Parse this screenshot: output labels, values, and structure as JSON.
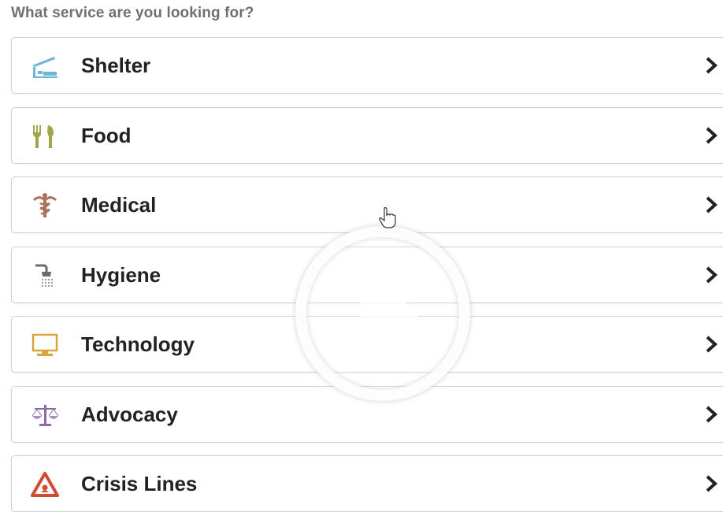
{
  "heading": "What service are you looking for?",
  "services": [
    {
      "label": "Shelter",
      "icon": "shelter-icon",
      "color": "#5aa6c8"
    },
    {
      "label": "Food",
      "icon": "food-icon",
      "color": "#9aa248"
    },
    {
      "label": "Medical",
      "icon": "medical-icon",
      "color": "#a9735a"
    },
    {
      "label": "Hygiene",
      "icon": "hygiene-icon",
      "color": "#6c6c6c"
    },
    {
      "label": "Technology",
      "icon": "technology-icon",
      "color": "#d6a63c"
    },
    {
      "label": "Advocacy",
      "icon": "advocacy-icon",
      "color": "#8e6aa8"
    },
    {
      "label": "Crisis Lines",
      "icon": "crisis-icon",
      "color": "#d24a2f"
    }
  ],
  "chevron_icon": "chevron-right-icon",
  "overlay": {
    "icon": "play-icon"
  }
}
